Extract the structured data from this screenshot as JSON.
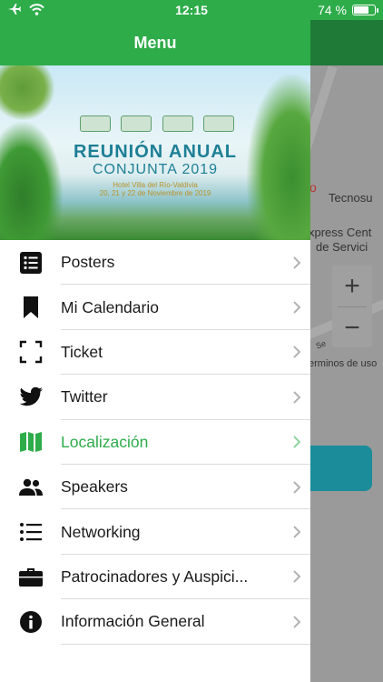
{
  "status_bar": {
    "time": "12:15",
    "battery_text": "74 %",
    "battery_level": 0.74
  },
  "drawer": {
    "title": "Menu",
    "banner": {
      "title_line1": "REUNIÓN ANUAL",
      "title_line2": "CONJUNTA 2019",
      "venue": "Hotel Villa del Río-Valdivia",
      "dates": "20, 21 y 22 de Noviembre de 2019"
    },
    "items": [
      {
        "label": "Posters",
        "icon": "list-box-icon",
        "active": false
      },
      {
        "label": "Mi Calendario",
        "icon": "bookmark-icon",
        "active": false
      },
      {
        "label": "Ticket",
        "icon": "scan-frame-icon",
        "active": false
      },
      {
        "label": "Twitter",
        "icon": "twitter-bird-icon",
        "active": false
      },
      {
        "label": "Localización",
        "icon": "map-icon",
        "active": true
      },
      {
        "label": "Speakers",
        "icon": "people-icon",
        "active": false
      },
      {
        "label": "Networking",
        "icon": "bulleted-list-icon",
        "active": false
      },
      {
        "label": "Patrocinadores y Auspici...",
        "icon": "briefcase-icon",
        "active": false
      },
      {
        "label": "Información General",
        "icon": "info-icon",
        "active": false
      }
    ]
  },
  "background": {
    "map_labels": {
      "place1": "Tecnosu",
      "place2_line1": "xpress Cent",
      "place2_line2": "de Servici",
      "terms": "erminos de uso",
      "street": "Se"
    },
    "zoom_in": "+",
    "zoom_out": "−"
  },
  "colors": {
    "accent": "#2eac4a",
    "active_text": "#2eac4a",
    "banner_title": "#1d7f95"
  }
}
